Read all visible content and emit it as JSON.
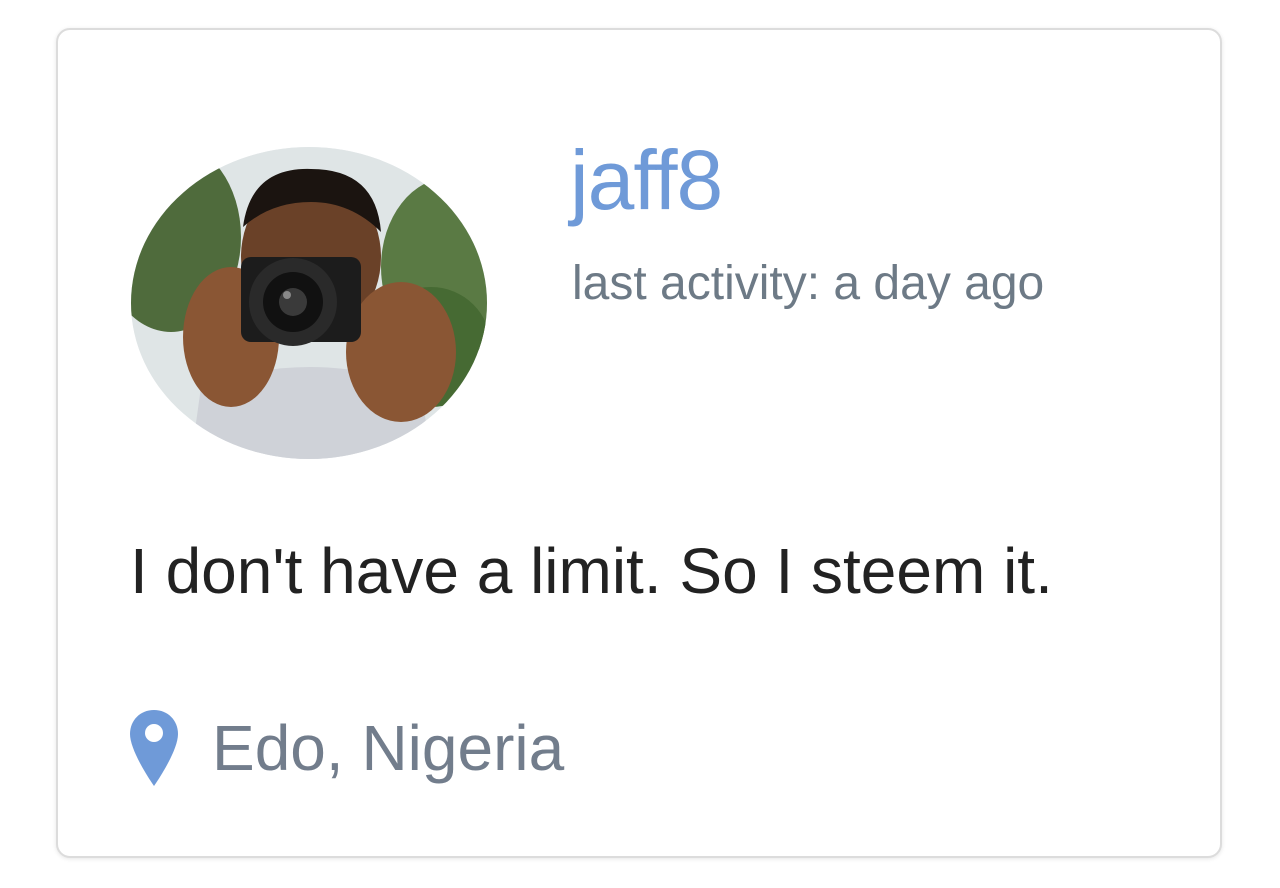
{
  "profile": {
    "username": "jaff8",
    "activity": "last activity: a day ago",
    "bio": "I don't have a limit. So I steem it.",
    "location": "Edo, Nigeria"
  },
  "icons": {
    "location": "map-pin-icon"
  },
  "colors": {
    "username": "#6f9ad8",
    "location_icon": "#6f9ad8",
    "activity_text": "#6d7a86",
    "bio_text": "#222222",
    "location_text": "#727d8c",
    "card_border": "#dcdcdc"
  }
}
